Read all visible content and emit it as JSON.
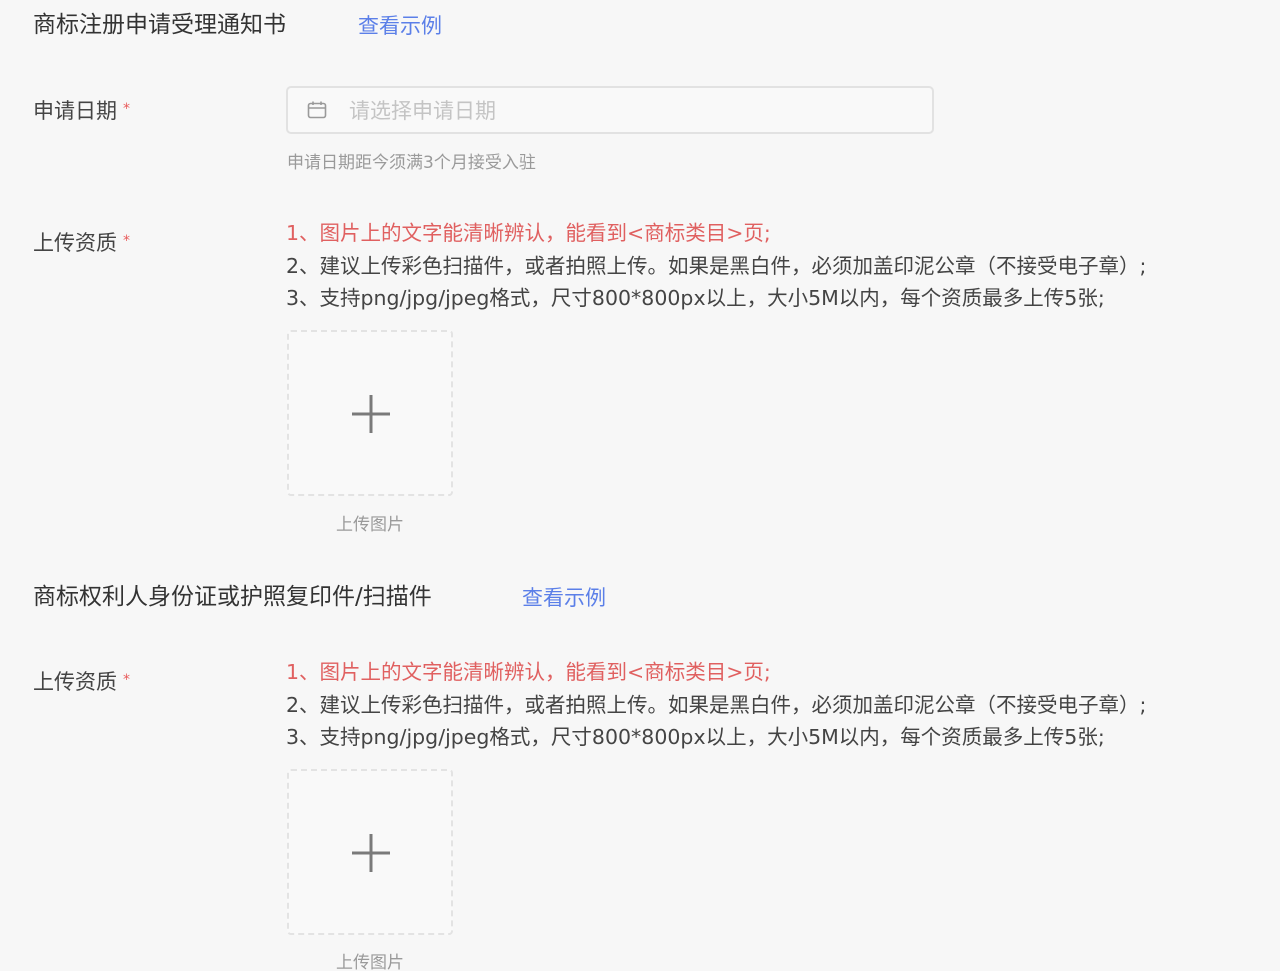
{
  "sections": [
    {
      "title": "商标注册申请受理通知书",
      "example_link": "查看示例",
      "date_field": {
        "label": "申请日期",
        "required_mark": "*",
        "placeholder": "请选择申请日期",
        "hint": "申请日期距今须满3个月接受入驻"
      },
      "upload": {
        "label": "上传资质",
        "required_mark": "*",
        "requirements": [
          "1、图片上的文字能清晰辨认，能看到<商标类目>页;",
          "2、建议上传彩色扫描件，或者拍照上传。如果是黑白件，必须加盖印泥公章（不接受电子章）;",
          "3、支持png/jpg/jpeg格式，尺寸800*800px以上，大小5M以内，每个资质最多上传5张;"
        ],
        "button_label": "上传图片"
      }
    },
    {
      "title": "商标权利人身份证或护照复印件/扫描件",
      "example_link": "查看示例",
      "upload": {
        "label": "上传资质",
        "required_mark": "*",
        "requirements": [
          "1、图片上的文字能清晰辨认，能看到<商标类目>页;",
          "2、建议上传彩色扫描件，或者拍照上传。如果是黑白件，必须加盖印泥公章（不接受电子章）;",
          "3、支持png/jpg/jpeg格式，尺寸800*800px以上，大小5M以内，每个资质最多上传5张;"
        ],
        "button_label": "上传图片"
      }
    }
  ],
  "colors": {
    "background": "#f7f7f7",
    "link": "#5b7fe8",
    "required": "#e85a5a",
    "warning_text": "#e06060",
    "body_text": "#444444",
    "muted_text": "#9a9a9a"
  },
  "icons": {
    "date_input": "calendar-icon",
    "upload_box": "plus-icon"
  }
}
